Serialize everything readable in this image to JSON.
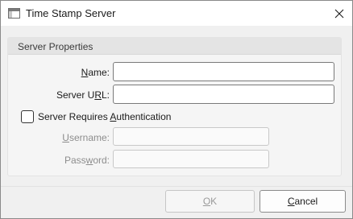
{
  "window": {
    "title": "Time Stamp Server"
  },
  "group": {
    "title": "Server Properties"
  },
  "fields": {
    "name": {
      "label_mnemonic": "N",
      "label_rest": "ame:",
      "value": ""
    },
    "url": {
      "label_pre": "Server U",
      "label_mnemonic": "R",
      "label_post": "L:",
      "value": ""
    },
    "auth": {
      "label_pre": "Server Requires ",
      "label_mnemonic": "A",
      "label_post": "uthentication",
      "checked": false
    },
    "username": {
      "label_mnemonic": "U",
      "label_rest": "sername:",
      "value": ""
    },
    "password": {
      "label_pre": "Pass",
      "label_mnemonic": "w",
      "label_post": "ord:",
      "value": ""
    }
  },
  "buttons": {
    "ok": {
      "mnemonic": "O",
      "rest": "K"
    },
    "cancel": {
      "mnemonic": "C",
      "rest": "ancel"
    }
  },
  "icons": {
    "app": "window-icon",
    "close": "close-icon"
  }
}
